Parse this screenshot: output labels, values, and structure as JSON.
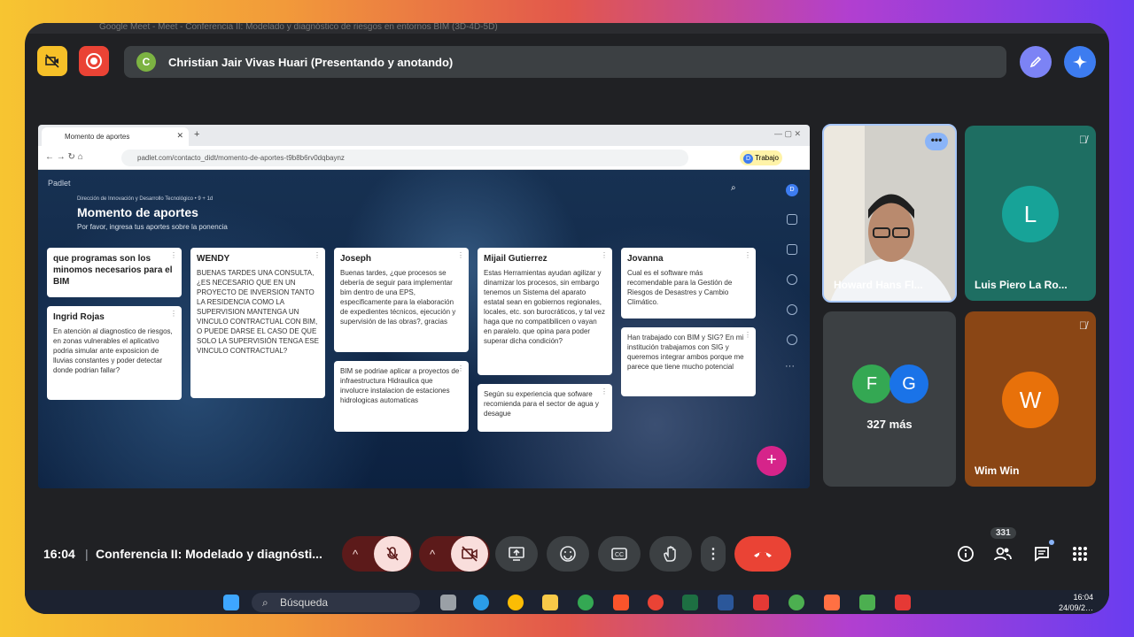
{
  "browser_title": "Google Meet - Meet - Conferencia II: Modelado y diagnóstico de riesgos en entornos BIM (3D-4D-5D)",
  "presenter": {
    "initial": "C",
    "label": "Christian Jair Vivas Huari (Presentando y anotando)"
  },
  "shared": {
    "tab_title": "Momento de aportes",
    "url": "padlet.com/contacto_didt/momento-de-aportes-t9b8b6rv0dqbaynz",
    "profile_initial": "D",
    "profile_label": "Trabajo",
    "padlet_brand": "Padlet",
    "org_line": "Dirección de Innovación y Desarrollo Tecnológico • 9 + 1d",
    "board_title": "Momento de aportes",
    "board_subtitle": "Por favor, ingresa tus aportes sobre la ponencia",
    "fab": "+",
    "cards": [
      {
        "title": "que programas son los minomos  necesarios para el BIM",
        "body": ""
      },
      {
        "title": "Ingrid Rojas",
        "body": "En atención al diagnostico de riesgos, en zonas vulnerables el aplicativo podria simular ante exposicion de lluvias constantes y poder detectar donde podrian fallar?"
      },
      {
        "title": "WENDY",
        "body": "BUENAS TARDES UNA CONSULTA, ¿ES NECESARIO QUE EN UN PROYECTO DE INVERSION TANTO LA RESIDENCIA COMO LA SUPERVISION MANTENGA UN VINCULO CONTRACTUAL CON BIM, O PUEDE DARSE EL CASO DE QUE SOLO LA SUPERVISIÓN TENGA ESE VINCULO CONTRACTUAL?"
      },
      {
        "title": "Joseph",
        "body": "Buenas tardes, ¿que procesos se debería de seguir para implementar bim dentro de una EPS, especificamente para la elaboración de expedientes técnicos, ejecución y supervisión de las obras?, gracias"
      },
      {
        "title": "",
        "body": "BIM se podriae aplicar a proyectos de infraestructura Hidraulica que involucre instalacion de estaciones hidrologicas automaticas"
      },
      {
        "title": "Mijail Gutierrez",
        "body": "Estas Herramientas ayudan agilizar y dinamizar los procesos, sin embargo tenemos un Sistema del aparato estatal sean en gobiernos regionales, locales, etc. son burocráticos, y tal vez haga que no compatibilicen o vayan en paralelo. que opina para poder superar dicha condición?"
      },
      {
        "title": "",
        "body": "Según su experiencia que sofware recomienda para el sector de agua y desague"
      },
      {
        "title": "Jovanna",
        "body": "Cual es el software más recomendable para la Gestión de Riesgos de Desastres y Cambio Climático."
      },
      {
        "title": "",
        "body": "Han trabajado con BIM y SIG? En mi institución trabajamos con SIG y queremos integrar ambos porque me parece que tiene mucho potencial"
      }
    ]
  },
  "participants": {
    "howard": "Howard Hans Fl...",
    "luis": {
      "initial": "L",
      "name": "Luis Piero La Ro..."
    },
    "group": {
      "a": "F",
      "b": "G",
      "more": "327 más"
    },
    "wim": {
      "initial": "W",
      "name": "Wim Win"
    }
  },
  "bottom": {
    "time": "16:04",
    "separator": "|",
    "title": "Conferencia II: Modelado y diagnósti...",
    "people_count": "331"
  },
  "taskbar": {
    "search": "Búsqueda",
    "clock_time": "16:04",
    "clock_date": "24/09/2…"
  },
  "colors": {
    "accent_blue": "#8ab4f8",
    "end_call_red": "#ea4335",
    "record_red": "#ea4335",
    "padlet_fab": "#d6248a"
  }
}
